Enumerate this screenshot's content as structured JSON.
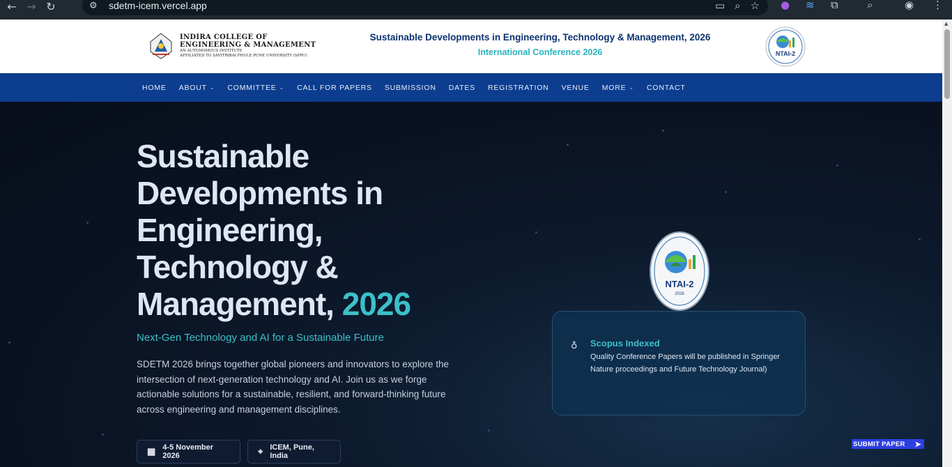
{
  "browser": {
    "url": "sdetm-icem.vercel.app",
    "icons": [
      "back-icon",
      "forward-icon",
      "reload-icon",
      "site-settings-icon",
      "install-icon",
      "zoom-icon",
      "bookmark-star-icon",
      "extension-icon",
      "wifi-icon",
      "puzzle-icon",
      "lens-icon",
      "avatar-icon",
      "menu-icon"
    ]
  },
  "header": {
    "college_line1": "INDIRA COLLEGE OF",
    "college_line2": "ENGINEERING & MANAGEMENT",
    "college_line3": "AN AUTONOMOUS INSTITUTE",
    "college_line4": "AFFILIATED TO SAVITRIBAI PHULE PUNE UNIVERSITY (SPPU)",
    "logo_word": "INDIRA",
    "title": "Sustainable Developments in Engineering, Technology & Management, 2026",
    "subtitle": "International Conference 2026",
    "badge_text": "NTAI-2"
  },
  "nav": {
    "items": [
      {
        "label": "HOME",
        "dropdown": false
      },
      {
        "label": "ABOUT",
        "dropdown": true
      },
      {
        "label": "COMMITTEE",
        "dropdown": true
      },
      {
        "label": "CALL FOR PAPERS",
        "dropdown": false
      },
      {
        "label": "SUBMISSION",
        "dropdown": false
      },
      {
        "label": "DATES",
        "dropdown": false
      },
      {
        "label": "REGISTRATION",
        "dropdown": false
      },
      {
        "label": "VENUE",
        "dropdown": false
      },
      {
        "label": "MORE",
        "dropdown": true
      },
      {
        "label": "CONTACT",
        "dropdown": false
      }
    ]
  },
  "hero": {
    "title_lines": [
      "Sustainable",
      "Developments in",
      "Engineering,",
      "Technology &"
    ],
    "title_last": "Management, ",
    "title_year": "2026",
    "tagline": "Next-Gen Technology and AI for a Sustainable Future",
    "description": "SDETM 2026 brings together global pioneers and innovators to explore the intersection of next-generation technology and AI. Join us as we forge actionable solutions for a sustainable, resilient, and forward-thinking future across engineering and management disciplines.",
    "date": "4-5 November 2026",
    "venue": "ICEM, Pune, India",
    "badge_text": "NTAI-2",
    "badge_year": "2026"
  },
  "scopus": {
    "title": "Scopus Indexed",
    "text": "Quality Conference Papers will be published in Springer Nature proceedings and Future Technology Journal)"
  },
  "submit": {
    "label": "SUBMIT PAPER"
  },
  "colors": {
    "nav_bg": "#0c3d8f",
    "accent_teal": "#3cc0c8",
    "title_navy": "#0c3270",
    "submit_bg": "#2d3fe0"
  }
}
